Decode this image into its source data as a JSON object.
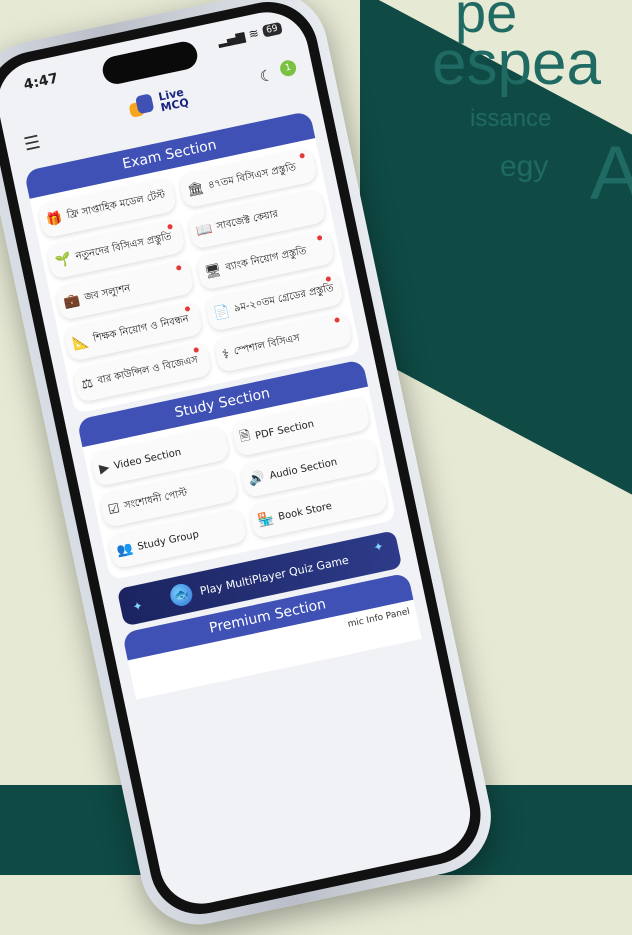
{
  "background_words": [
    "pe",
    "espea",
    "issance",
    "egy",
    "A"
  ],
  "status": {
    "time": "4:47",
    "battery": "69"
  },
  "app": {
    "logo_top": "Live",
    "logo_bottom": "MCQ",
    "bell_badge": "1"
  },
  "exam_section": {
    "title": "Exam Section",
    "items": [
      {
        "label": "ফ্রি সাপ্তাহিক মডেল টেস্ট",
        "icon": "gift-icon",
        "badge": false
      },
      {
        "label": "৪৭তম বিসিএস প্রস্তুতি",
        "icon": "bank-icon",
        "badge": true
      },
      {
        "label": "নতুনদের বিসিএস প্রস্তুতি",
        "icon": "seedling-icon",
        "badge": true
      },
      {
        "label": "সাবজেক্ট কেয়ার",
        "icon": "book-open-icon",
        "badge": false
      },
      {
        "label": "জব সল্যুশন",
        "icon": "briefcase-icon",
        "badge": true
      },
      {
        "label": "ব্যাংক নিয়োগ প্রস্তুতি",
        "icon": "monitor-icon",
        "badge": true
      },
      {
        "label": "শিক্ষক নিয়োগ ও নিবন্ধন",
        "icon": "triangle-ruler-icon",
        "badge": true
      },
      {
        "label": "৯ম-২০তম গ্রেডের প্রস্তুতি",
        "icon": "document-icon",
        "badge": true
      },
      {
        "label": "বার কাউন্সিল ও বিজেএস",
        "icon": "scale-icon",
        "badge": true
      },
      {
        "label": "স্পেশাল বিসিএস",
        "icon": "stethoscope-icon",
        "badge": true
      }
    ]
  },
  "study_section": {
    "title": "Study Section",
    "items": [
      {
        "label": "Video Section",
        "icon": "play-icon"
      },
      {
        "label": "PDF Section",
        "icon": "pdf-icon"
      },
      {
        "label": "সংশোধনী পোস্ট",
        "icon": "checkbox-icon"
      },
      {
        "label": "Audio Section",
        "icon": "audio-icon"
      },
      {
        "label": "Study Group",
        "icon": "group-icon"
      },
      {
        "label": "Book Store",
        "icon": "store-icon"
      }
    ]
  },
  "game_banner": {
    "label": "Play MultiPlayer Quiz Game"
  },
  "premium_section": {
    "title": "Premium Section",
    "item": "mic Info Panel"
  }
}
